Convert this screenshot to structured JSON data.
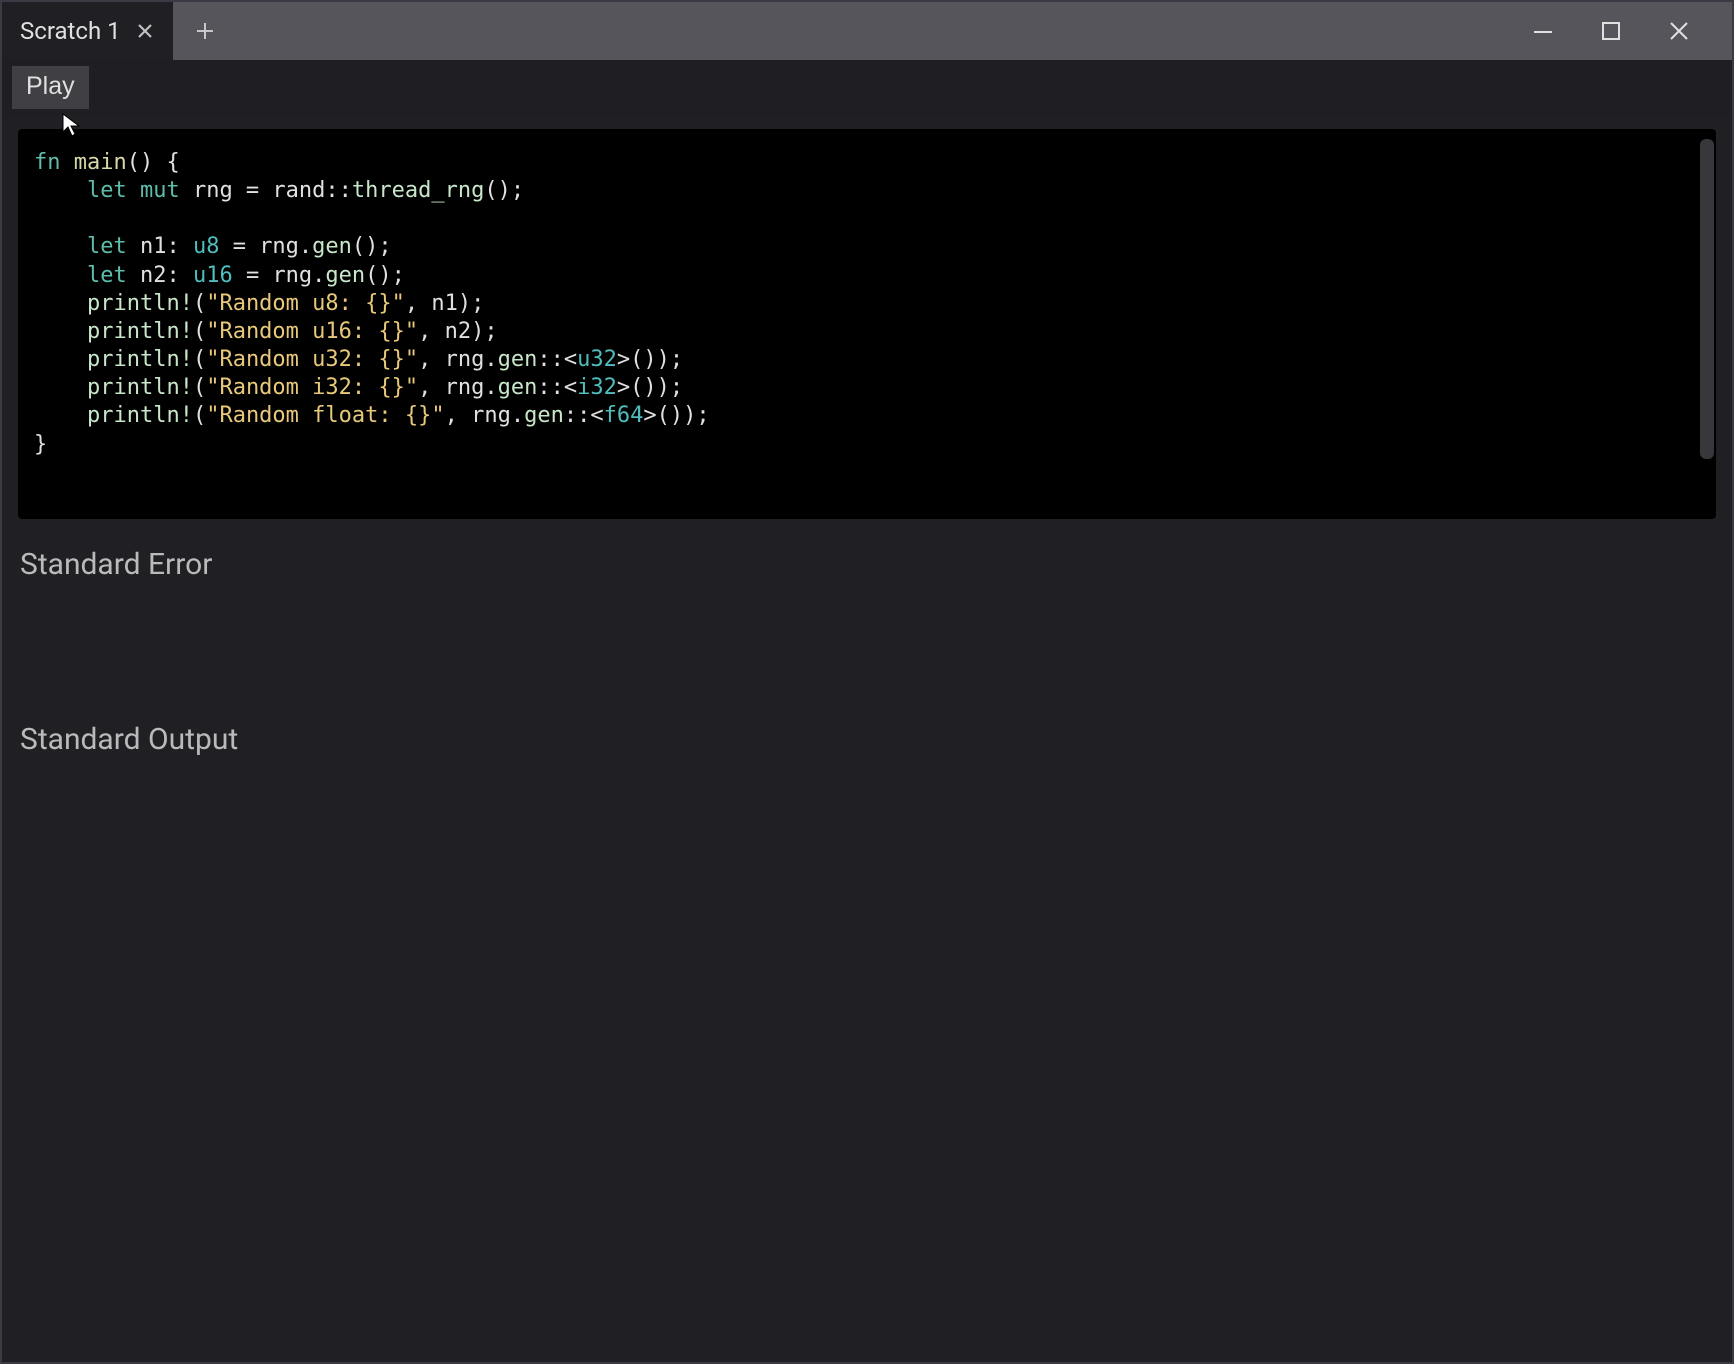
{
  "titlebar": {
    "tab_name": "Scratch 1"
  },
  "toolbar": {
    "play_label": "Play"
  },
  "code": {
    "tokens": [
      {
        "t": "fn ",
        "c": "kw"
      },
      {
        "t": "main",
        "c": "fn"
      },
      {
        "t": "() {",
        "c": "punct"
      },
      {
        "t": "\n",
        "c": ""
      },
      {
        "t": "    ",
        "c": ""
      },
      {
        "t": "let ",
        "c": "kw"
      },
      {
        "t": "mut ",
        "c": "kw"
      },
      {
        "t": "rng = rand::",
        "c": "var"
      },
      {
        "t": "thread_rng",
        "c": "call"
      },
      {
        "t": "();",
        "c": "punct"
      },
      {
        "t": "\n",
        "c": ""
      },
      {
        "t": "\n",
        "c": ""
      },
      {
        "t": "    ",
        "c": ""
      },
      {
        "t": "let ",
        "c": "kw"
      },
      {
        "t": "n1: ",
        "c": "var"
      },
      {
        "t": "u8",
        "c": "type"
      },
      {
        "t": " = rng.",
        "c": "var"
      },
      {
        "t": "gen",
        "c": "call"
      },
      {
        "t": "();",
        "c": "punct"
      },
      {
        "t": "\n",
        "c": ""
      },
      {
        "t": "    ",
        "c": ""
      },
      {
        "t": "let ",
        "c": "kw"
      },
      {
        "t": "n2: ",
        "c": "var"
      },
      {
        "t": "u16",
        "c": "type"
      },
      {
        "t": " = rng.",
        "c": "var"
      },
      {
        "t": "gen",
        "c": "call"
      },
      {
        "t": "();",
        "c": "punct"
      },
      {
        "t": "\n",
        "c": ""
      },
      {
        "t": "    ",
        "c": ""
      },
      {
        "t": "println!",
        "c": "call"
      },
      {
        "t": "(",
        "c": "punct"
      },
      {
        "t": "\"Random u8: {}\"",
        "c": "str"
      },
      {
        "t": ", n1);",
        "c": "punct"
      },
      {
        "t": "\n",
        "c": ""
      },
      {
        "t": "    ",
        "c": ""
      },
      {
        "t": "println!",
        "c": "call"
      },
      {
        "t": "(",
        "c": "punct"
      },
      {
        "t": "\"Random u16: {}\"",
        "c": "str"
      },
      {
        "t": ", n2);",
        "c": "punct"
      },
      {
        "t": "\n",
        "c": ""
      },
      {
        "t": "    ",
        "c": ""
      },
      {
        "t": "println!",
        "c": "call"
      },
      {
        "t": "(",
        "c": "punct"
      },
      {
        "t": "\"Random u32: {}\"",
        "c": "str"
      },
      {
        "t": ", rng.",
        "c": "var"
      },
      {
        "t": "gen",
        "c": "call"
      },
      {
        "t": "::<",
        "c": "punct"
      },
      {
        "t": "u32",
        "c": "type"
      },
      {
        "t": ">());",
        "c": "punct"
      },
      {
        "t": "\n",
        "c": ""
      },
      {
        "t": "    ",
        "c": ""
      },
      {
        "t": "println!",
        "c": "call"
      },
      {
        "t": "(",
        "c": "punct"
      },
      {
        "t": "\"Random i32: {}\"",
        "c": "str"
      },
      {
        "t": ", rng.",
        "c": "var"
      },
      {
        "t": "gen",
        "c": "call"
      },
      {
        "t": "::<",
        "c": "punct"
      },
      {
        "t": "i32",
        "c": "type"
      },
      {
        "t": ">());",
        "c": "punct"
      },
      {
        "t": "\n",
        "c": ""
      },
      {
        "t": "    ",
        "c": ""
      },
      {
        "t": "println!",
        "c": "call"
      },
      {
        "t": "(",
        "c": "punct"
      },
      {
        "t": "\"Random float: {}\"",
        "c": "str"
      },
      {
        "t": ", rng.",
        "c": "var"
      },
      {
        "t": "gen",
        "c": "call"
      },
      {
        "t": "::<",
        "c": "punct"
      },
      {
        "t": "f64",
        "c": "type"
      },
      {
        "t": ">());",
        "c": "punct"
      },
      {
        "t": "\n",
        "c": ""
      },
      {
        "t": "}",
        "c": "punct"
      }
    ]
  },
  "sections": {
    "stderr": "Standard Error",
    "stdout": "Standard Output"
  }
}
